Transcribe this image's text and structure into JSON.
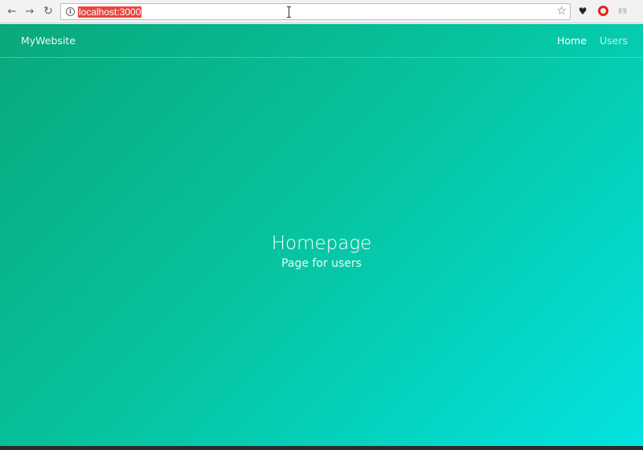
{
  "browser": {
    "back_icon": "arrow-left",
    "forward_icon": "arrow-right",
    "reload_icon": "reload",
    "url": "localhost:3000",
    "info_glyph": "i",
    "extensions": [
      "gnome-icon",
      "opera-icon",
      "radio-icon"
    ]
  },
  "navbar": {
    "brand": "MyWebsite",
    "links": [
      {
        "label": "Home",
        "active": true
      },
      {
        "label": "Users",
        "active": false
      }
    ]
  },
  "hero": {
    "title": "Homepage",
    "subtitle": "Page for users"
  },
  "colors": {
    "gradient_start": "#0aa87c",
    "gradient_end": "#03e3e0",
    "url_highlight": "#e8473f"
  }
}
